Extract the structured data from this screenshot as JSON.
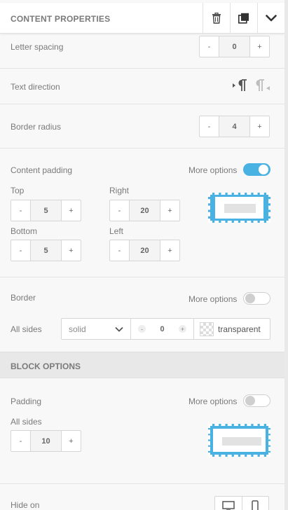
{
  "header": {
    "title": "CONTENT PROPERTIES",
    "actions": [
      {
        "name": "delete-button",
        "icon": "trash-icon"
      },
      {
        "name": "duplicate-button",
        "icon": "duplicate-icon"
      },
      {
        "name": "collapse-button",
        "icon": "chevron-down-icon"
      }
    ]
  },
  "letter_spacing": {
    "label": "Letter spacing",
    "value": "0",
    "minus": "-",
    "plus": "+"
  },
  "text_direction": {
    "label": "Text direction",
    "options": [
      "ltr-icon",
      "rtl-icon"
    ],
    "selected": "ltr"
  },
  "border_radius": {
    "label": "Border radius",
    "value": "4",
    "minus": "-",
    "plus": "+"
  },
  "content_padding": {
    "label": "Content padding",
    "more_options_label": "More options",
    "more_options_on": true,
    "top": {
      "label": "Top",
      "value": "5"
    },
    "right": {
      "label": "Right",
      "value": "20"
    },
    "bottom": {
      "label": "Bottom",
      "value": "5"
    },
    "left": {
      "label": "Left",
      "value": "20"
    },
    "minus": "-",
    "plus": "+"
  },
  "border": {
    "label": "Border",
    "more_options_label": "More options",
    "more_options_on": false,
    "all_sides_label": "All sides",
    "style": "solid",
    "width": "0",
    "minus": "-",
    "plus": "+",
    "color": "transparent"
  },
  "block_options": {
    "title": "BLOCK OPTIONS",
    "padding": {
      "label": "Padding",
      "more_options_label": "More options",
      "more_options_on": false,
      "all_sides_label": "All sides",
      "value": "10",
      "minus": "-",
      "plus": "+"
    },
    "hide_on": {
      "label": "Hide on",
      "options": [
        "desktop-icon",
        "mobile-icon"
      ]
    }
  },
  "colors": {
    "accent": "#4ab1e3",
    "header_bg": "#ffffff",
    "panel_bg": "#f8f8f8",
    "section_bg": "#e8e8e8"
  }
}
